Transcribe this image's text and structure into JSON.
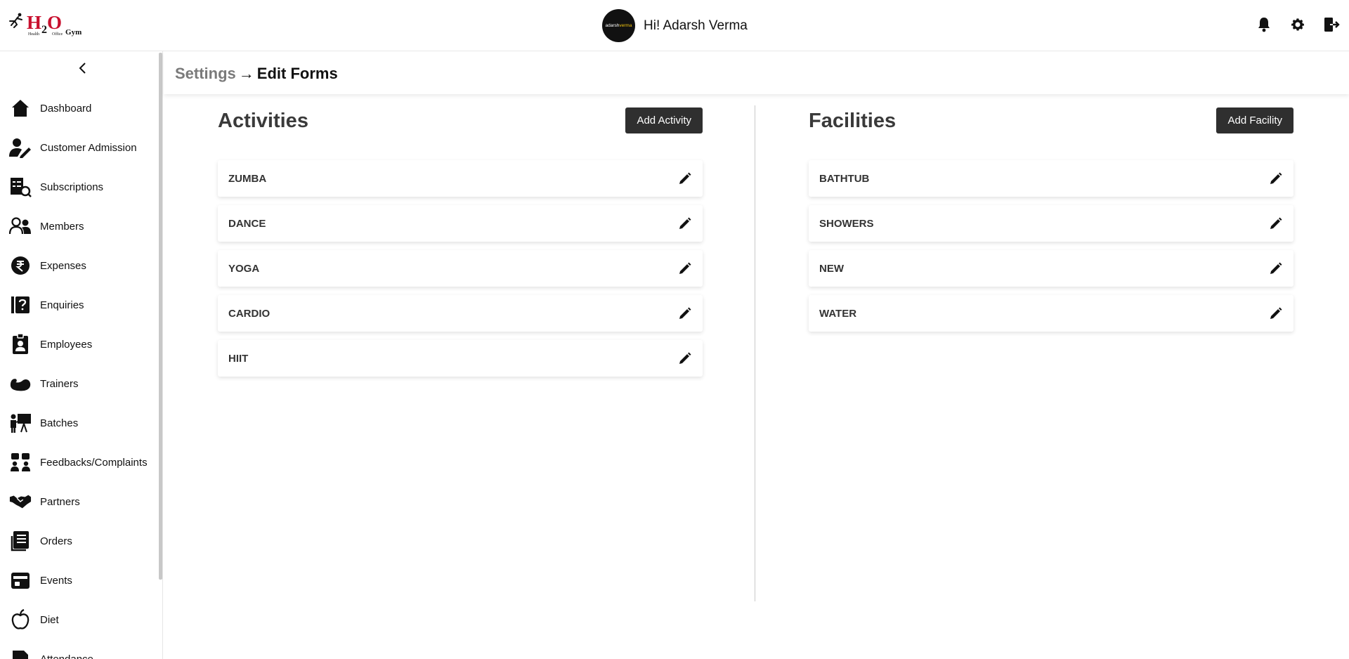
{
  "header": {
    "brand": {
      "h": "H",
      "two": "2",
      "o": "O",
      "gym": "Gym",
      "sub1": "Health",
      "sub2": "Office"
    },
    "avatar_text": "adarsh",
    "avatar_text_accent": "verma",
    "greeting": "Hi! Adarsh Verma",
    "icons": [
      "bell-icon",
      "gear-icon",
      "logout-icon"
    ]
  },
  "sidebar": {
    "items": [
      {
        "label": "Dashboard",
        "icon": "home-icon"
      },
      {
        "label": "Customer Admission",
        "icon": "user-edit-icon"
      },
      {
        "label": "Subscriptions",
        "icon": "subscription-icon"
      },
      {
        "label": "Members",
        "icon": "members-icon"
      },
      {
        "label": "Expenses",
        "icon": "rupee-icon"
      },
      {
        "label": "Enquiries",
        "icon": "enquiry-icon"
      },
      {
        "label": "Employees",
        "icon": "badge-icon"
      },
      {
        "label": "Trainers",
        "icon": "muscle-icon"
      },
      {
        "label": "Batches",
        "icon": "presenter-icon"
      },
      {
        "label": "Feedbacks/Complaints",
        "icon": "feedback-icon"
      },
      {
        "label": "Partners",
        "icon": "handshake-icon"
      },
      {
        "label": "Orders",
        "icon": "orders-icon"
      },
      {
        "label": "Events",
        "icon": "calendar-icon"
      },
      {
        "label": "Diet",
        "icon": "apple-icon"
      },
      {
        "label": "Attendance",
        "icon": "attendance-icon"
      }
    ]
  },
  "breadcrumb": {
    "parent": "Settings",
    "separator": "→",
    "current": "Edit Forms"
  },
  "activities": {
    "title": "Activities",
    "add_label": "Add Activity",
    "items": [
      "ZUMBA",
      "DANCE",
      "YOGA",
      "CARDIO",
      "HIIT"
    ]
  },
  "facilities": {
    "title": "Facilities",
    "add_label": "Add Facility",
    "items": [
      "BATHTUB",
      "SHOWERS",
      "NEW",
      "WATER"
    ]
  }
}
